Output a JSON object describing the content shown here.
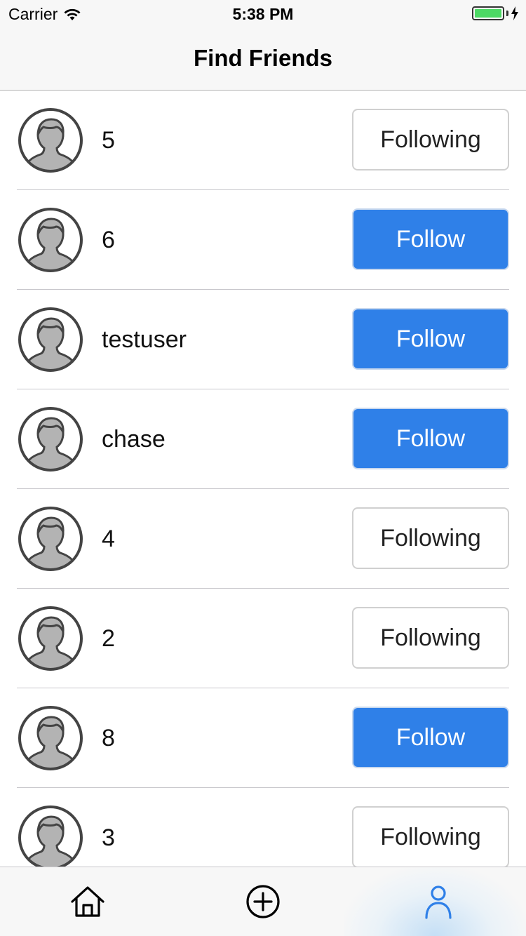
{
  "status_bar": {
    "carrier": "Carrier",
    "time": "5:38 PM",
    "battery_color": "#4cd964"
  },
  "nav": {
    "title": "Find Friends"
  },
  "users": [
    {
      "name": "5",
      "button_label": "Following",
      "state": "following"
    },
    {
      "name": "6",
      "button_label": "Follow",
      "state": "follow"
    },
    {
      "name": "testuser",
      "button_label": "Follow",
      "state": "follow"
    },
    {
      "name": "chase",
      "button_label": "Follow",
      "state": "follow"
    },
    {
      "name": "4",
      "button_label": "Following",
      "state": "following"
    },
    {
      "name": "2",
      "button_label": "Following",
      "state": "following"
    },
    {
      "name": "8",
      "button_label": "Follow",
      "state": "follow"
    },
    {
      "name": "3",
      "button_label": "Following",
      "state": "following"
    }
  ],
  "tab_bar": {
    "tabs": [
      {
        "icon": "home-icon",
        "active": false
      },
      {
        "icon": "add-circle-icon",
        "active": false
      },
      {
        "icon": "profile-icon",
        "active": true
      }
    ],
    "active_color": "#2f80e8"
  },
  "colors": {
    "follow_button": "#2f80e8",
    "following_button_border": "#d0d0d0"
  }
}
